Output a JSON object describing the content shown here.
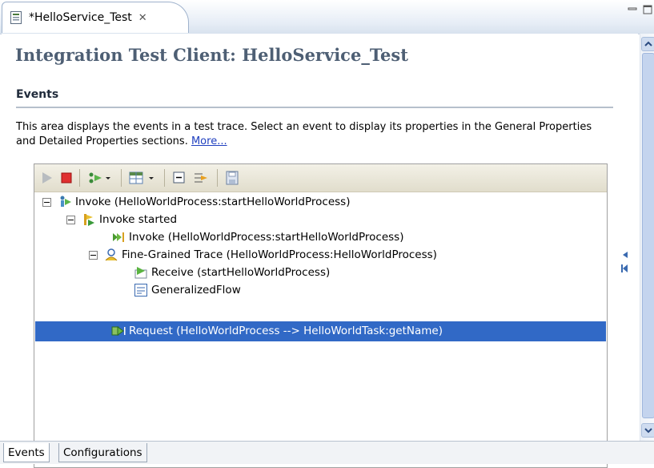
{
  "editor_tab": {
    "title": "*HelloService_Test",
    "close_glyph": "✕",
    "icon": "test-file-icon"
  },
  "form": {
    "title": "Integration Test Client: HelloService_Test",
    "section_title": "Events",
    "description": "This area displays the events in a test trace. Select an event to display its properties in the General Properties and Detailed Properties sections.",
    "more_link": "More..."
  },
  "toolbar": {
    "buttons": [
      "play-icon",
      "stop-icon",
      "invoke-dropdown-icon",
      "table-dropdown-icon",
      "collapse-all-icon",
      "filter-icon",
      "save-icon"
    ]
  },
  "tree": {
    "nodes": [
      {
        "label": "Invoke (HelloWorldProcess:startHelloWorldProcess)",
        "icon": "invoke-icon",
        "expanded": true
      },
      {
        "label": "Invoke started",
        "icon": "invoke-started-icon",
        "expanded": true
      },
      {
        "label": "Invoke (HelloWorldProcess:startHelloWorldProcess)",
        "icon": "invoke-arrow-icon"
      },
      {
        "label": "Fine-Grained Trace (HelloWorldProcess:HelloWorldProcess)",
        "icon": "trace-icon",
        "expanded": true
      },
      {
        "label": "Receive (startHelloWorldProcess)",
        "icon": "receive-icon"
      },
      {
        "label": "GeneralizedFlow",
        "icon": "flow-icon"
      },
      {
        "label": "Request (HelloWorldProcess --> HelloWorldTask:getName)",
        "icon": "request-icon",
        "selected": true
      }
    ]
  },
  "page_tabs": [
    {
      "label": "Events",
      "active": true
    },
    {
      "label": "Configurations",
      "active": false
    }
  ],
  "colors": {
    "selection": "#3169c6",
    "form_title": "#4e5f74",
    "link": "#1f3fbf"
  }
}
